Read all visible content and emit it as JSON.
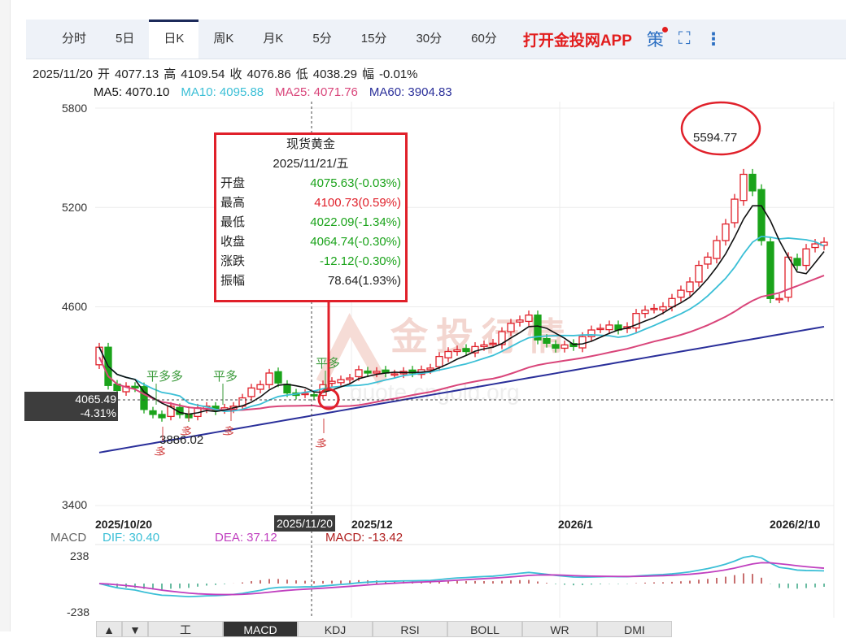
{
  "toolbar": {
    "tabs": [
      "分时",
      "5日",
      "日K",
      "周K",
      "月K",
      "5分",
      "15分",
      "30分",
      "60分"
    ],
    "active": 2,
    "app_link": "打开金投网APP",
    "strategy": "策"
  },
  "info": {
    "date": "2025/11/20",
    "open_label": "开",
    "open": "4077.13",
    "high_label": "高",
    "high": "4109.54",
    "close_label": "收",
    "close": "4076.86",
    "low_label": "低",
    "low": "4038.29",
    "amp_label": "幅",
    "amp": "-0.01%"
  },
  "ma": {
    "ma5": "MA5: 4070.10",
    "ma10": "MA10: 4095.88",
    "ma25": "MA25: 4071.76",
    "ma60": "MA60: 3904.83"
  },
  "colors": {
    "up": "#e0202a",
    "down": "#1aa31a",
    "ma5": "#111111",
    "ma10": "#3bbfd6",
    "ma25": "#d9457a",
    "ma60": "#2a2f9a",
    "dif": "#3bbfd6",
    "dea": "#c03fbf"
  },
  "tooltip": {
    "title": "现货黄金",
    "date": "2025/11/21/五",
    "rows": [
      {
        "label": "开盘",
        "value": "4075.63(-0.03%)",
        "color": "#1aa31a"
      },
      {
        "label": "最高",
        "value": "4100.73(0.59%)",
        "color": "#e0202a"
      },
      {
        "label": "最低",
        "value": "4022.09(-1.34%)",
        "color": "#1aa31a"
      },
      {
        "label": "收盘",
        "value": "4064.74(-0.30%)",
        "color": "#1aa31a"
      },
      {
        "label": "涨跌",
        "value": "-12.12(-0.30%)",
        "color": "#1aa31a"
      },
      {
        "label": "振幅",
        "value": "78.64(1.93%)",
        "color": "#222222"
      }
    ]
  },
  "crosshair": {
    "price": "4065.49",
    "pct": "-4.31%",
    "date": "2025/11/20"
  },
  "annotations": {
    "high": "5594.77",
    "low": "3886.02",
    "ping_duo": "平多",
    "ping_duo2": "平多多",
    "duo": "多"
  },
  "watermark": {
    "cn": "金投行情",
    "url": "quote.cngold.org"
  },
  "macd": {
    "label": "MACD",
    "dif": "DIF: 30.40",
    "dea": "DEA: 37.12",
    "macd": "MACD: -13.42",
    "ymax": "238",
    "ymin": "-238"
  },
  "bottom_tabs": [
    "▲",
    "▼",
    "工",
    "MACD",
    "KDJ",
    "RSI",
    "BOLL",
    "WR",
    "DMI"
  ],
  "chart_data": {
    "type": "candlestick",
    "y_ticks": [
      "5800",
      "5200",
      "4600",
      "3400"
    ],
    "ylim": [
      3400,
      5800
    ],
    "x_ticks": [
      "2025/10/20",
      "2025/12",
      "2026/1",
      "2026/2/10"
    ],
    "closes": [
      4356,
      4125,
      4095,
      4120,
      4110,
      3980,
      3950,
      3930,
      4000,
      3950,
      3930,
      3990,
      4000,
      3970,
      3990,
      4000,
      4050,
      4110,
      4130,
      4200,
      4140,
      4080,
      4065,
      4077,
      4065,
      4130,
      4150,
      4160,
      4170,
      4220,
      4200,
      4210,
      4200,
      4195,
      4210,
      4200,
      4220,
      4230,
      4300,
      4330,
      4340,
      4330,
      4360,
      4370,
      4380,
      4450,
      4500,
      4520,
      4550,
      4400,
      4380,
      4350,
      4370,
      4360,
      4420,
      4460,
      4470,
      4490,
      4460,
      4480,
      4560,
      4580,
      4590,
      4600,
      4650,
      4700,
      4750,
      4850,
      4900,
      5000,
      5100,
      5250,
      5400,
      5300,
      5000,
      4650,
      4650,
      4900,
      4850,
      4950,
      4980,
      4990
    ],
    "first_open": 4250,
    "ma60_range": [
      3720,
      4480
    ]
  }
}
